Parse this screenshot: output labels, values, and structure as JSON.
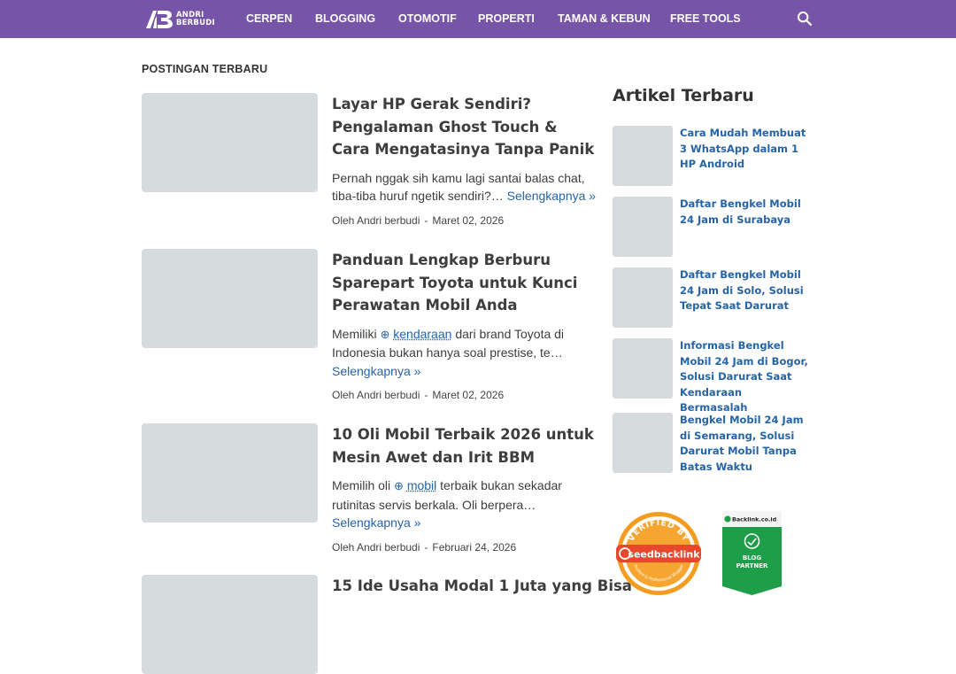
{
  "header": {
    "logo_text_line1": "ANDRI",
    "logo_text_line2": "BERBUDI",
    "nav": [
      "CERPEN",
      "BLOGGING",
      "OTOMOTIF",
      "PROPERTI",
      "TAMAN & KEBUN",
      "FREE TOOLS"
    ],
    "search_icon": "search-icon",
    "bar_color": "#7654a7"
  },
  "main": {
    "section_title": "POSTINGAN TERBARU",
    "posts": [
      {
        "title": "Layar HP Gerak Sendiri? Pengalaman Ghost Touch & Cara Mengatasinya Tanpa Panik",
        "snippet": "Pernah nggak sih kamu lagi santai balas chat, tiba-tiba huruf ngetik sendiri?…",
        "keyword": "",
        "snippet_after": "",
        "more": "Selengkapnya »",
        "author": "Oleh Andri berbudi",
        "date": "Maret 02, 2026"
      },
      {
        "title": "Panduan Lengkap Berburu Sparepart Toyota untuk Kunci Perawatan Mobil Anda",
        "snippet": "Memiliki",
        "keyword": "kendaraan",
        "snippet_after": "dari brand Toyota di Indonesia bukan hanya soal prestise, te…",
        "more": "Selengkapnya »",
        "author": "Oleh Andri berbudi",
        "date": "Maret 02, 2026"
      },
      {
        "title": "10 Oli Mobil Terbaik 2026 untuk Mesin Awet dan Irit BBM",
        "snippet": "Memilih oli",
        "keyword": "mobil",
        "snippet_after": "terbaik bukan sekadar rutinitas servis berkala. Oli berpera…",
        "more": "Selengkapnya »",
        "author": "Oleh Andri berbudi",
        "date": "Februari 24, 2026"
      },
      {
        "title": "15 Ide Usaha Modal 1 Juta yang Bisa",
        "snippet": "",
        "keyword": "",
        "snippet_after": "",
        "more": "",
        "author": "",
        "date": ""
      }
    ],
    "keyword_icon": "plus-circle-icon"
  },
  "sidebar": {
    "title": "Artikel Terbaru",
    "items": [
      "Cara Mudah Membuat 3 WhatsApp dalam 1 HP Android",
      "Daftar Bengkel Mobil 24 Jam di Surabaya",
      "Daftar Bengkel Mobil 24 Jam di Solo, Solusi Tepat Saat Darurat",
      "Informasi Bengkel Mobil 24 Jam di Bogor, Solusi Darurat Saat Kendaraan Bermasalah",
      "Bengkel Mobil 24 Jam di Semarang, Solusi Darurat Mobil Tanpa Batas Waktu"
    ]
  },
  "badges": {
    "seedbacklink_top": "VERIFIED BY",
    "seedbacklink_name": "seedbacklink",
    "seedbacklink_bottom": "Trusted & Professional Blogger",
    "backlink_brand": "Backlink.co.id",
    "backlink_label1": "BLOG",
    "backlink_label2": "PARTNER"
  },
  "colors": {
    "accent": "#7654a7",
    "link": "#2664a8",
    "thumb": "#d6dcdd"
  }
}
